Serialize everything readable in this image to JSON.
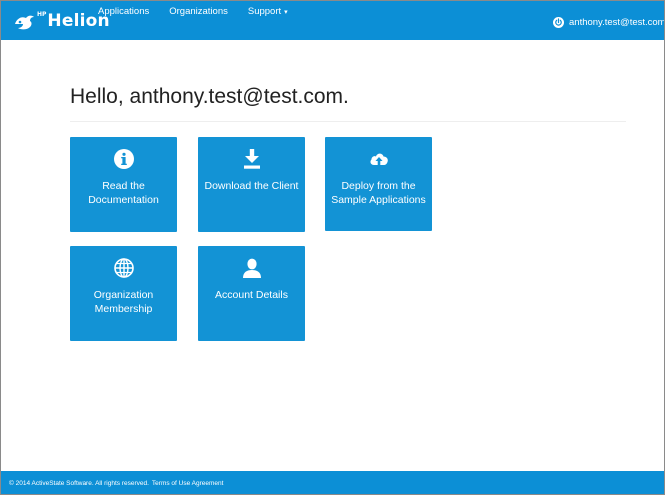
{
  "navbar": {
    "brand": {
      "hp": "HP",
      "name": "Helion",
      "logo_icon": "hp-helion-logo-icon"
    },
    "links": [
      {
        "label": "Applications"
      },
      {
        "label": "Organizations"
      },
      {
        "label": "Support",
        "caret": "▾"
      }
    ],
    "user": {
      "icon": "power-icon",
      "email": "anthony.test@test.com"
    }
  },
  "main": {
    "greeting": "Hello, anthony.test@test.com.",
    "tiles": [
      {
        "icon": "info-icon",
        "label": "Read the Documentation"
      },
      {
        "icon": "download-icon",
        "label": "Download the Client"
      },
      {
        "icon": "cloud-upload-icon",
        "label": "Deploy from the Sample Applications"
      },
      {
        "icon": "globe-icon",
        "label": "Organization Membership"
      },
      {
        "icon": "user-icon",
        "label": "Account Details"
      }
    ]
  },
  "footer": {
    "copyright": "© 2014 ActiveState Software. All rights reserved.",
    "terms_link": "Terms of Use Agreement"
  },
  "colors": {
    "navbar": "#0c8fd6",
    "tile": "#1393d5",
    "footer": "#0c8fd6",
    "text": "#222222"
  }
}
